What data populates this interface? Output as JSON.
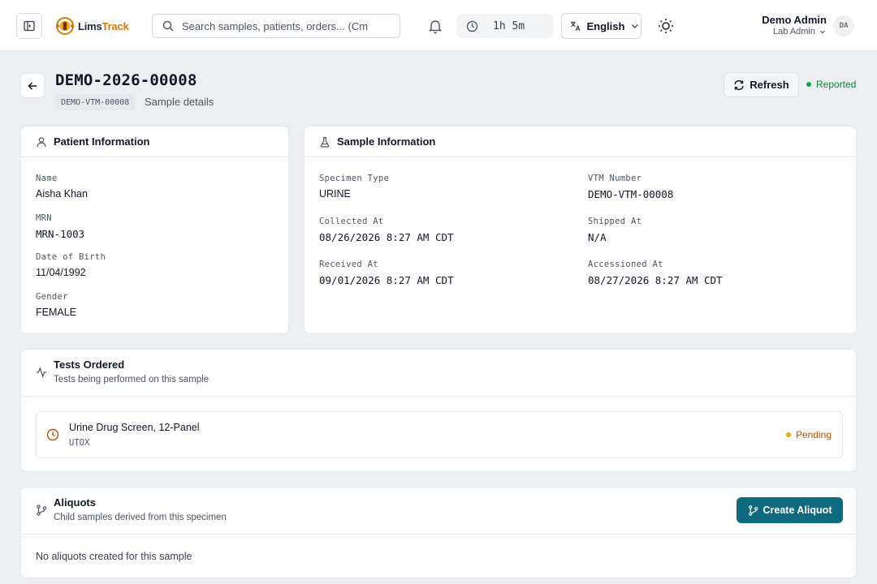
{
  "topbar": {
    "logo": {
      "part1": "Lims",
      "part2": "Track"
    },
    "search": {
      "placeholder": "Search samples, patients, orders... (Cm"
    },
    "timer": "1h 5m",
    "language": "English",
    "user": {
      "name": "Demo Admin",
      "role": "Lab Admin",
      "initials": "DA"
    }
  },
  "header": {
    "title": "DEMO-2026-00008",
    "vtm_chip": "DEMO-VTM-00008",
    "subtitle": "Sample details",
    "refresh_label": "Refresh",
    "status": "Reported",
    "status_color": "#16a34a"
  },
  "patient": {
    "title": "Patient Information",
    "fields": [
      {
        "label": "Name",
        "value": "Aisha Khan"
      },
      {
        "label": "MRN",
        "value": "MRN-1003"
      },
      {
        "label": "Date of Birth",
        "value": "11/04/1992"
      },
      {
        "label": "Gender",
        "value": "FEMALE"
      }
    ]
  },
  "sample": {
    "title": "Sample Information",
    "fields": [
      {
        "label": "Specimen Type",
        "value": "URINE"
      },
      {
        "label": "VTM Number",
        "value": "DEMO-VTM-00008"
      },
      {
        "label": "Collected At",
        "value": "08/26/2026 8:27 AM CDT"
      },
      {
        "label": "Shipped At",
        "value": "N/A"
      },
      {
        "label": "Received At",
        "value": "09/01/2026 8:27 AM CDT"
      },
      {
        "label": "Accessioned At",
        "value": "08/27/2026 8:27 AM CDT"
      }
    ]
  },
  "tests": {
    "title": "Tests Ordered",
    "description": "Tests being performed on this sample",
    "items": [
      {
        "name": "Urine Drug Screen, 12-Panel",
        "code": "UTOX",
        "status": "Pending",
        "status_color": "#f59e0b"
      }
    ]
  },
  "aliquots": {
    "title": "Aliquots",
    "description": "Child samples derived from this specimen",
    "create_label": "Create Aliquot",
    "empty_text": "No aliquots created for this sample"
  },
  "colors": {
    "accent": "#0e6a7e",
    "brand": "#d97706"
  }
}
